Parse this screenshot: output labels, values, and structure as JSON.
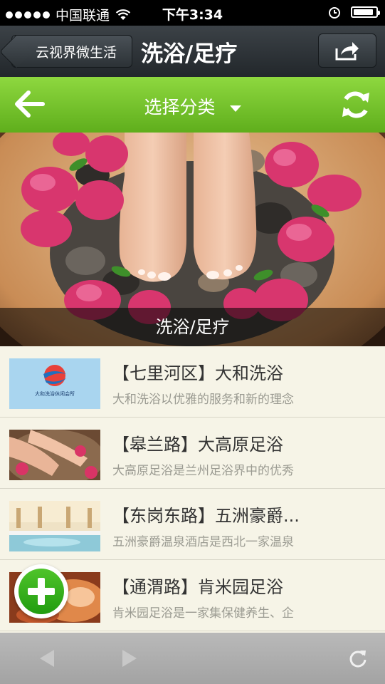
{
  "status_bar": {
    "carrier": "中国联通",
    "time": "下午3:34",
    "battery_level": 0.9
  },
  "nav": {
    "back_label": "云视界微生活",
    "title": "洗浴/足疗",
    "share_icon": "share-icon"
  },
  "category_bar": {
    "label": "选择分类",
    "back_icon": "arrow-left-icon",
    "refresh_icon": "refresh-icon"
  },
  "hero": {
    "caption": "洗浴/足疗"
  },
  "list": [
    {
      "title": "【七里河区】大和洗浴",
      "desc": "大和洗浴以优雅的服务和新的理念",
      "thumb_text": "大和洗浴休闲会所"
    },
    {
      "title": "【皋兰路】大高原足浴",
      "desc": "大高原足浴是兰州足浴界中的优秀"
    },
    {
      "title": "【东岗东路】五洲豪爵...",
      "desc": "五洲豪爵温泉酒店是西北一家温泉"
    },
    {
      "title": "【通渭路】肯米园足浴",
      "desc": "肯米园足浴是一家集保健养生、企"
    }
  ],
  "colors": {
    "green_bar": "#6fc02a",
    "nav_bar": "#2e3438"
  }
}
